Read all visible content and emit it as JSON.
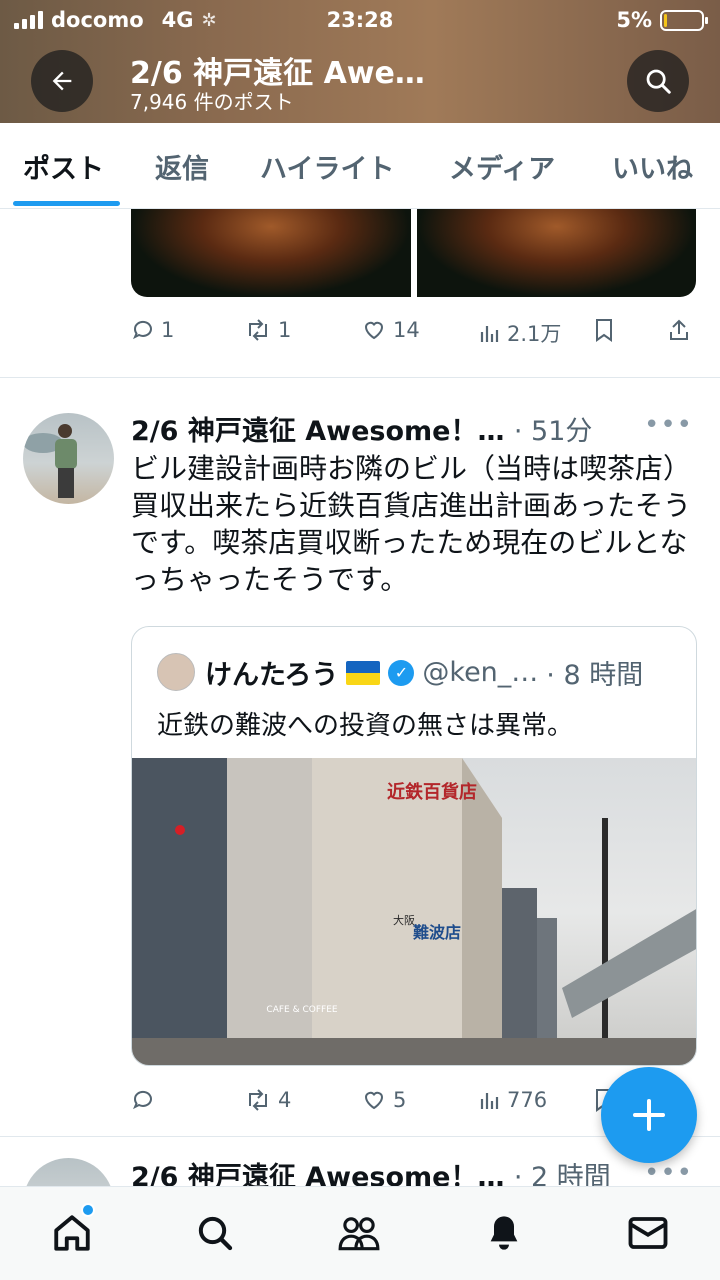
{
  "status_bar": {
    "carrier": "docomo",
    "network": "4G",
    "time": "23:28",
    "battery": "5%",
    "battery_level": 0.05
  },
  "header": {
    "title": "2/6 神戸遠征 Awe…",
    "post_count": "7,946 件のポスト"
  },
  "tabs": [
    {
      "label": "ポスト",
      "active": true
    },
    {
      "label": "返信"
    },
    {
      "label": "ハイライト"
    },
    {
      "label": "メディア"
    },
    {
      "label": "いいね"
    }
  ],
  "posts": [
    {
      "actions": {
        "replies": "1",
        "reposts": "1",
        "likes": "14",
        "views": "2.1万"
      }
    },
    {
      "author": "2/6 神戸遠征 Awesome！…",
      "time": "· 51分",
      "text": "ビル建設計画時お隣のビル（当時は喫茶店）買収出来たら近鉄百貨店進出計画あったそうです。喫茶店買収断ったため現在のビルとなっちゃったそうです。",
      "quote": {
        "name": "けんたろう",
        "handle": "@ken_…",
        "time": "· 8 時間",
        "text": "近鉄の難波への投資の無さは異常。",
        "photo_signs": {
          "building_top": "近鉄百貨店",
          "building_mid": "難波店",
          "building_small": "大阪",
          "shop": "CAFE & COFFEE"
        }
      },
      "actions": {
        "replies": "",
        "reposts": "4",
        "likes": "5",
        "views": "776"
      }
    },
    {
      "author": "2/6 神戸遠征 Awesome！…",
      "time": "· 2 時間"
    }
  ],
  "icons": {
    "back": "arrow-left-icon",
    "search": "search-icon",
    "reply": "comment-icon",
    "repost": "repost-icon",
    "like": "heart-icon",
    "views": "bar-chart-icon",
    "bookmark": "bookmark-icon",
    "share": "share-icon",
    "compose": "plus-icon",
    "home": "home-icon",
    "explore": "search-icon",
    "communities": "people-icon",
    "notifications": "bell-icon",
    "messages": "mail-icon"
  },
  "colors": {
    "accent": "#1d9bf0",
    "text": "#0f1419",
    "secondary": "#536471"
  }
}
